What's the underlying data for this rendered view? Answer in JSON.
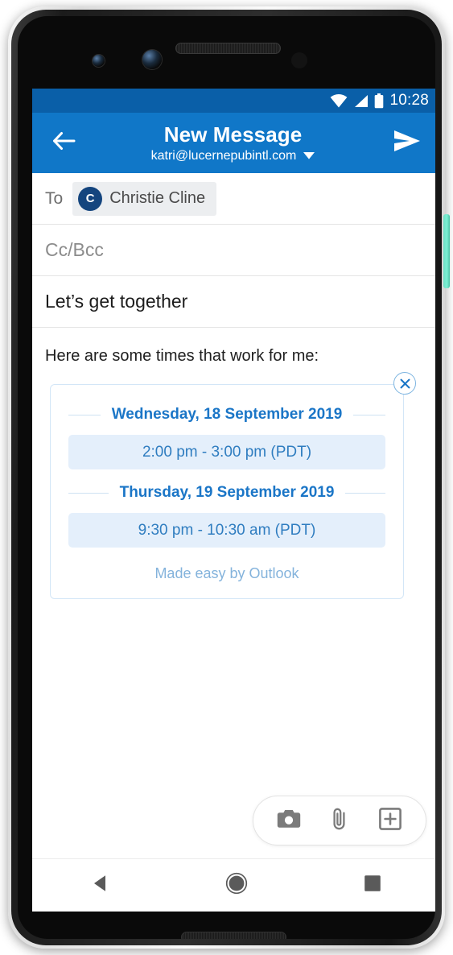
{
  "status_bar": {
    "time": "10:28",
    "icons": [
      "wifi-icon",
      "cellular-signal-icon",
      "battery-icon"
    ],
    "background_color": "#0a5fa8"
  },
  "app_bar": {
    "background_color": "#1077c8",
    "back_icon": "back-arrow-icon",
    "title": "New Message",
    "account_email": "katri@lucernepubintl.com",
    "account_dropdown_icon": "chevron-down-icon",
    "send_icon": "send-icon"
  },
  "compose": {
    "to_label": "To",
    "recipient": {
      "avatar_initial": "C",
      "name": "Christie Cline",
      "avatar_color": "#14457e",
      "chip_background": "#eceef0"
    },
    "ccbcc_placeholder": "Cc/Bcc",
    "subject_value": "Let’s get together",
    "body_text": "Here are some times that work for me:"
  },
  "times_card": {
    "close_icon": "close-icon",
    "border_color": "#d3e6f7",
    "accent_color": "#1b76c7",
    "slot_background": "#e4effb",
    "slot_text_color": "#2f7dc0",
    "blocks": [
      {
        "date": "Wednesday, 18 September 2019",
        "slots": [
          "2:00 pm - 3:00 pm (PDT)"
        ]
      },
      {
        "date": "Thursday, 19 September 2019",
        "slots": [
          "9:30 pm - 10:30 am (PDT)"
        ]
      }
    ],
    "footer": "Made easy by Outlook",
    "footer_color": "#84b3dc"
  },
  "attachment_toolbar": {
    "buttons": [
      {
        "icon": "camera-icon",
        "label": "Camera"
      },
      {
        "icon": "paperclip-icon",
        "label": "Attach file"
      },
      {
        "icon": "insert-plus-icon",
        "label": "Insert"
      }
    ]
  },
  "nav_bar": {
    "buttons": [
      {
        "icon": "back-triangle-icon",
        "label": "Back"
      },
      {
        "icon": "home-circle-icon",
        "label": "Home"
      },
      {
        "icon": "recents-square-icon",
        "label": "Recents"
      }
    ]
  },
  "device": {
    "power_button_color": "#6bdfc4"
  }
}
